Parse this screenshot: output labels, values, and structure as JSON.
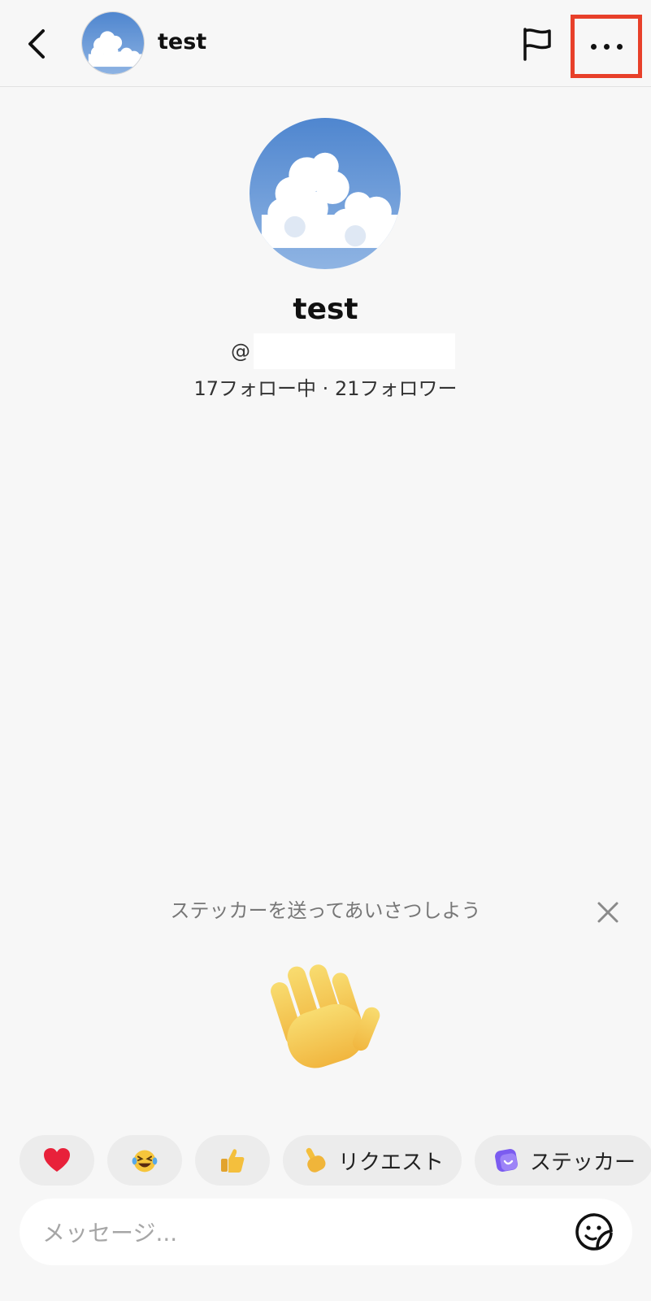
{
  "header": {
    "title": "test",
    "icons": {
      "back": "back-chevron-icon",
      "flag": "flag-icon",
      "more": "more-dots-icon"
    }
  },
  "profile": {
    "name": "test",
    "handle_prefix": "@",
    "stats": "17フォロー中 · 21フォロワー"
  },
  "sticker_prompt": {
    "text": "ステッカーを送ってあいさつしよう",
    "icon": "waving-hand-icon"
  },
  "quick_replies": [
    {
      "icon": "red-heart-icon",
      "label": ""
    },
    {
      "icon": "laughing-tears-emoji-icon",
      "label": ""
    },
    {
      "icon": "thumbs-up-icon",
      "label": ""
    },
    {
      "icon": "pointing-hand-icon",
      "label": "リクエスト"
    },
    {
      "icon": "sticker-icon",
      "label": "ステッカー"
    }
  ],
  "composer": {
    "placeholder": "メッセージ...",
    "value": "",
    "icon": "emoji-sticker-icon"
  },
  "colors": {
    "highlight": "#e8402a",
    "background": "#f7f7f7",
    "sticker_accent": "#7b5cf0"
  }
}
